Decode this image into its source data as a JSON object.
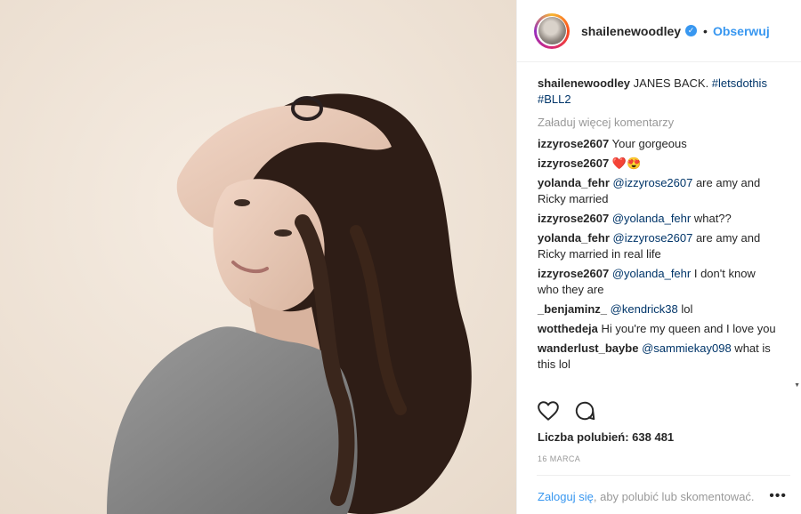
{
  "post": {
    "username": "shailenewoodley",
    "verified_icon": "verified-badge-icon",
    "separator": "•",
    "follow_label": "Obserwuj",
    "accent": "#3897f0"
  },
  "caption": {
    "username": "shailenewoodley",
    "text": " JANES BACK. ",
    "tag1": "#letsdothis",
    "tag2": "#BLL2"
  },
  "load_more": "Załaduj więcej komentarzy",
  "comments": [
    {
      "user": "izzyrose2607",
      "mention": "",
      "text": " Your gorgeous"
    },
    {
      "user": "izzyrose2607",
      "mention": "",
      "text": " ❤️😍"
    },
    {
      "user": "yolanda_fehr",
      "mention": "@izzyrose2607",
      "text": " are amy and Ricky married"
    },
    {
      "user": "izzyrose2607",
      "mention": "@yolanda_fehr",
      "text": " what??"
    },
    {
      "user": "yolanda_fehr",
      "mention": "@izzyrose2607",
      "text": " are amy and Ricky married in real life"
    },
    {
      "user": "izzyrose2607",
      "mention": "@yolanda_fehr",
      "text": " I don't know who they are"
    },
    {
      "user": "_benjaminz_",
      "mention": "@kendrick38",
      "text": " lol"
    },
    {
      "user": "wotthedeja",
      "mention": "",
      "text": " Hi you're my queen and I love you"
    },
    {
      "user": "wanderlust_baybe",
      "mention": "@sammiekay098",
      "text": " what is this lol"
    }
  ],
  "likes": "Liczba polubień: 638 481",
  "date": "16 MARCA",
  "footer": {
    "login": "Zaloguj się",
    "rest": ", aby polubić lub skomentować.",
    "more": "•••"
  }
}
